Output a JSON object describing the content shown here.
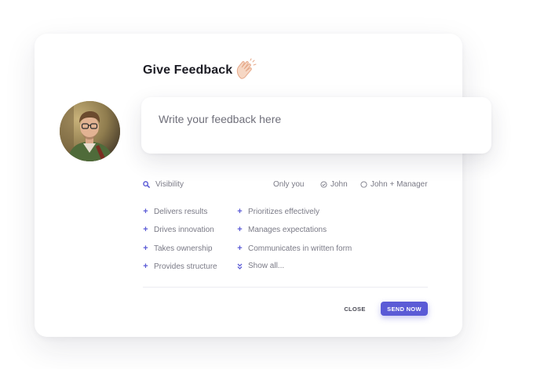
{
  "header": {
    "title": "Give Feedback",
    "emoji_icon": "clapping-hands-icon"
  },
  "feedback_input": {
    "placeholder": "Write your feedback here",
    "value": ""
  },
  "visibility": {
    "label": "Visibility",
    "icon": "search-icon",
    "options": [
      {
        "label": "Only you",
        "selected": false
      },
      {
        "label": "John",
        "selected": true
      },
      {
        "label": "John + Manager",
        "selected": false
      }
    ]
  },
  "tags": {
    "left": [
      "Delivers results",
      "Drives innovation",
      "Takes ownership",
      "Provides structure"
    ],
    "right": [
      "Prioritizes effectively",
      "Manages expectations",
      "Communicates in written form"
    ],
    "show_all": "Show all..."
  },
  "actions": {
    "close_label": "CLOSE",
    "send_label": "SEND NOW"
  },
  "colors": {
    "accent": "#5b5bd6",
    "title": "#1c1c24",
    "muted": "#7a7a86"
  }
}
